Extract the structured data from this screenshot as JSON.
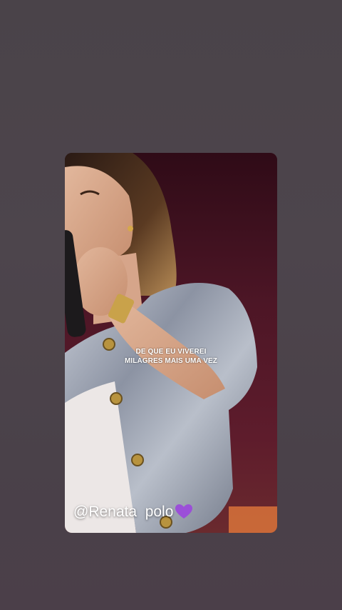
{
  "story": {
    "lyric_line1": "DE QUE EU VIVEREI",
    "lyric_line2": "MILAGRES MAIS UMA VEZ",
    "handle_text": "@Renata  polo",
    "heart_icon": "purple-heart-icon",
    "heart_color": "#9b4fd8"
  },
  "colors": {
    "page_background": "#4b4349",
    "stage_background": "#4a1424"
  }
}
